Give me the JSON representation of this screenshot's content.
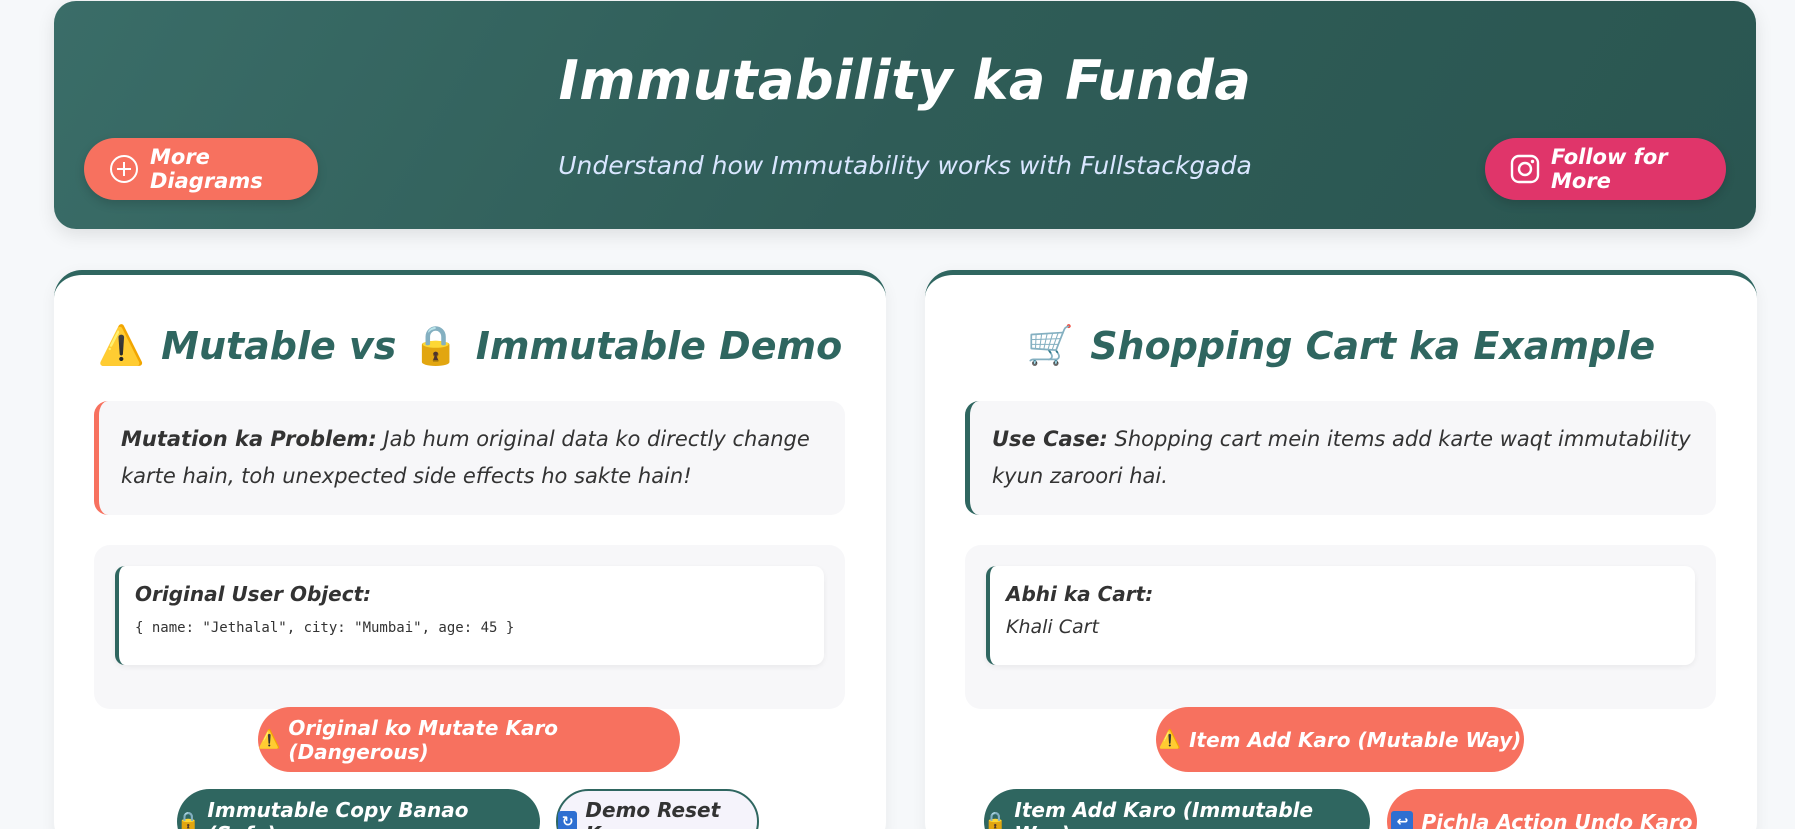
{
  "header": {
    "title": "Immutability ka Funda",
    "subtitle": "Understand how Immutability works with Fullstackgada",
    "more_diagrams_label": "More Diagrams",
    "follow_label": "Follow for More"
  },
  "left_card": {
    "title_part1": "Mutable vs",
    "title_part2": "Immutable Demo",
    "note_bold": "Mutation ka Problem:",
    "note_text": " Jab hum original data ko directly change karte hain, toh unexpected side effects ho sakte hain!",
    "box_label": "Original User Object:",
    "box_code": "{ name: \"Jethalal\", city: \"Mumbai\", age: 45 }",
    "btn_mutate": "Original ko Mutate Karo (Dangerous)",
    "btn_immutable": "Immutable Copy Banao (Safe)",
    "btn_reset": "Demo Reset Karo"
  },
  "right_card": {
    "title": "Shopping Cart ka Example",
    "note_bold": "Use Case:",
    "note_text": " Shopping cart mein items add karte waqt immutability kyun zaroori hai.",
    "box_label": "Abhi ka Cart:",
    "box_text": "Khali Cart",
    "btn_mutable": "Item Add Karo (Mutable Way)",
    "btn_immutable": "Item Add Karo (Immutable Way)",
    "btn_undo": "Pichla Action Undo Karo"
  },
  "colors": {
    "teal": "#2f6660",
    "coral": "#f7715f",
    "pink": "#e0356a"
  }
}
